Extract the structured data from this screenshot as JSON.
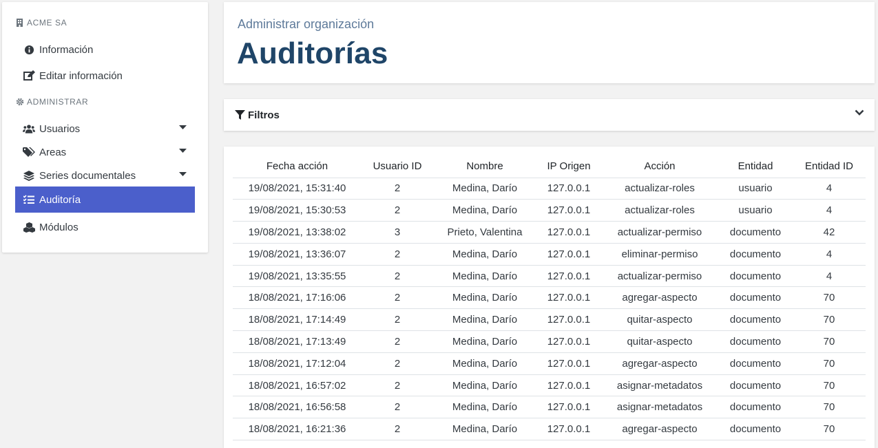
{
  "sidebar": {
    "org_name": "ACME SA",
    "admin_heading": "ADMINISTRAR",
    "items": [
      {
        "label": "Información",
        "icon": "info-circle-icon"
      },
      {
        "label": "Editar información",
        "icon": "edit-icon"
      },
      {
        "label": "Usuarios",
        "icon": "users-icon",
        "has_submenu": true
      },
      {
        "label": "Areas",
        "icon": "tags-icon",
        "has_submenu": true
      },
      {
        "label": "Series documentales",
        "icon": "layers-icon",
        "has_submenu": true
      },
      {
        "label": "Auditoría",
        "icon": "tasks-icon",
        "active": true
      },
      {
        "label": "Módulos",
        "icon": "cubes-icon"
      }
    ]
  },
  "header": {
    "subtitle": "Administrar organización",
    "title": "Auditorías"
  },
  "filters": {
    "label": "Filtros",
    "icon": "filter-icon",
    "toggle_icon": "chevron-down-icon"
  },
  "table": {
    "columns": [
      "Fecha acción",
      "Usuario ID",
      "Nombre",
      "IP Origen",
      "Acción",
      "Entidad",
      "Entidad ID"
    ],
    "rows": [
      [
        "19/08/2021, 15:31:40",
        "2",
        "Medina, Darío",
        "127.0.0.1",
        "actualizar-roles",
        "usuario",
        "4"
      ],
      [
        "19/08/2021, 15:30:53",
        "2",
        "Medina, Darío",
        "127.0.0.1",
        "actualizar-roles",
        "usuario",
        "4"
      ],
      [
        "19/08/2021, 13:38:02",
        "3",
        "Prieto, Valentina",
        "127.0.0.1",
        "actualizar-permiso",
        "documento",
        "42"
      ],
      [
        "19/08/2021, 13:36:07",
        "2",
        "Medina, Darío",
        "127.0.0.1",
        "eliminar-permiso",
        "documento",
        "4"
      ],
      [
        "19/08/2021, 13:35:55",
        "2",
        "Medina, Darío",
        "127.0.0.1",
        "actualizar-permiso",
        "documento",
        "4"
      ],
      [
        "18/08/2021, 17:16:06",
        "2",
        "Medina, Darío",
        "127.0.0.1",
        "agregar-aspecto",
        "documento",
        "70"
      ],
      [
        "18/08/2021, 17:14:49",
        "2",
        "Medina, Darío",
        "127.0.0.1",
        "quitar-aspecto",
        "documento",
        "70"
      ],
      [
        "18/08/2021, 17:13:49",
        "2",
        "Medina, Darío",
        "127.0.0.1",
        "quitar-aspecto",
        "documento",
        "70"
      ],
      [
        "18/08/2021, 17:12:04",
        "2",
        "Medina, Darío",
        "127.0.0.1",
        "agregar-aspecto",
        "documento",
        "70"
      ],
      [
        "18/08/2021, 16:57:02",
        "2",
        "Medina, Darío",
        "127.0.0.1",
        "asignar-metadatos",
        "documento",
        "70"
      ],
      [
        "18/08/2021, 16:56:58",
        "2",
        "Medina, Darío",
        "127.0.0.1",
        "asignar-metadatos",
        "documento",
        "70"
      ],
      [
        "18/08/2021, 16:21:36",
        "2",
        "Medina, Darío",
        "127.0.0.1",
        "agregar-aspecto",
        "documento",
        "70"
      ]
    ]
  },
  "colors": {
    "active_bg": "#4b5fcb",
    "title": "#1f4568",
    "subtitle": "#5e7a9a"
  }
}
